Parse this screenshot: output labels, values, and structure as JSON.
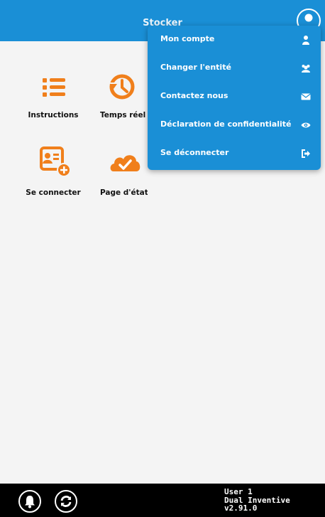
{
  "header": {
    "title": "Stocker"
  },
  "tiles": [
    {
      "label": "Instructions",
      "icon": "list-icon"
    },
    {
      "label": "Temps réel",
      "icon": "clock-icon"
    },
    {
      "label": "Se connecter",
      "icon": "id-card-plus-icon"
    },
    {
      "label": "Page d'état",
      "icon": "cloud-check-icon"
    }
  ],
  "menu": {
    "items": [
      {
        "label": "Mon compte",
        "icon": "user-icon"
      },
      {
        "label": "Changer l'entité",
        "icon": "users-icon"
      },
      {
        "label": "Contactez nous",
        "icon": "envelope-icon"
      },
      {
        "label": "Déclaration de confidentialité",
        "icon": "eye-icon"
      },
      {
        "label": "Se déconnecter",
        "icon": "sign-out-icon"
      }
    ]
  },
  "footer": {
    "user": "User 1",
    "company": "Dual Inventive",
    "version": "v2.91.0"
  },
  "colors": {
    "primary": "#1a8fd6",
    "accent": "#f07f1b",
    "footer": "#000000"
  }
}
